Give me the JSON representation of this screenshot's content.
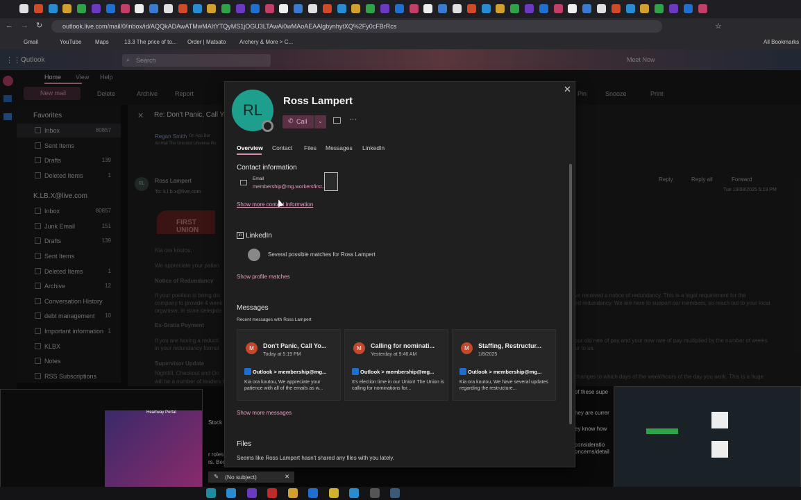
{
  "browser": {
    "url": "outlook.live.com/mail/0/inbox/id/AQQkADAwATMwMAItYTQyMS1jOGU3LTAwAi0wMAoAEAAlgbynhytXQ%2Fy0cFBrRcs",
    "bookmarks": [
      "Gmail",
      "YouTube",
      "Maps",
      "13.3 The price of to...",
      "Order | Matsato",
      "Archery & More > C..."
    ],
    "all_bookmarks": "All Bookmarks"
  },
  "outlook": {
    "app_name": "Outlook",
    "search_placeholder": "Search",
    "menu_tabs": [
      "Home",
      "View",
      "Help"
    ],
    "meet_now": "Meet Now",
    "ribbon": {
      "new_mail": "New mail",
      "delete": "Delete",
      "archive": "Archive",
      "report": "Report",
      "snooze": "Snooze",
      "print": "Print",
      "pin": "Pin"
    },
    "favorites_header": "Favorites",
    "favorites": [
      {
        "label": "Inbox",
        "count": "80857"
      },
      {
        "label": "Sent Items",
        "count": ""
      },
      {
        "label": "Drafts",
        "count": "139"
      },
      {
        "label": "Deleted Items",
        "count": "1"
      }
    ],
    "account": "K.LB.X@live.com",
    "folders": [
      {
        "label": "Inbox",
        "count": "80857"
      },
      {
        "label": "Junk Email",
        "count": "151"
      },
      {
        "label": "Drafts",
        "count": "139"
      },
      {
        "label": "Sent Items",
        "count": ""
      },
      {
        "label": "Deleted Items",
        "count": "1"
      },
      {
        "label": "Archive",
        "count": "12"
      },
      {
        "label": "Conversation History",
        "count": ""
      },
      {
        "label": "debt management",
        "count": "10"
      },
      {
        "label": "Important information",
        "count": "1"
      },
      {
        "label": "KLBX",
        "count": ""
      },
      {
        "label": "Notes",
        "count": ""
      },
      {
        "label": "RSS Subscriptions",
        "count": ""
      }
    ],
    "reading": {
      "subject": "Re: Don't Panic, Call Yo",
      "sender_initials": "RL",
      "sender": "Ross Lampert",
      "to": "To: k.l.b.x@live.com",
      "earlier_sender": "Regan Smith",
      "earlier_sender_app": "On App Bar",
      "earlier_preview": "All Hail The Unionist Universe Ro",
      "logo_text": "FIRST UNION",
      "date": "Tue 19/08/2025 5:19 PM",
      "actions": [
        "Reply",
        "Reply all",
        "Forward"
      ],
      "body_lines": [
        "Kia ora koutou,",
        "We appreciate your patien",
        "Notice of Redundancy",
        "If your position is being dis",
        "company to provide 4 week",
        "organiser, in store delegate",
        "Ex-Gratia Payment",
        "If you are having a reducti",
        "in your redundancy formul",
        "Supervisor Update",
        "Nightfill, Checkout and On",
        "will be a number of leaders th"
      ],
      "right_lines": [
        "ve received a notice of redundancy. This is a legal requirement for the",
        "ed redundancy. We are here to support our members, so reach out to your local",
        "our old rate of pay and your new rate of pay multiplied by the number of weeks",
        "ur to us.",
        "changes to which days of the week/hours of the day you work. This is a huge",
        "of these supe",
        "hey are currer",
        "ey know how",
        "consideratio",
        "oncerns/detail"
      ],
      "mid_fragments": [
        "Stock",
        "r roles",
        "rs. Becau"
      ]
    },
    "compose": "(No subject)"
  },
  "card": {
    "initials": "RL",
    "name": "Ross Lampert",
    "call_label": "Call",
    "tabs": [
      "Overview",
      "Contact",
      "Files",
      "Messages",
      "LinkedIn"
    ],
    "contact_header": "Contact information",
    "email_label": "Email",
    "email_value": "membership@mg.workersfirst...",
    "show_more_contact": "Show more contact information",
    "linkedin_header": "LinkedIn",
    "linkedin_matches": "Several possible matches for Ross Lampert",
    "show_profile_matches": "Show profile matches",
    "messages_header": "Messages",
    "recent_messages_label": "Recent messages with Ross Lampert",
    "messages": [
      {
        "initial": "M",
        "subject": "Don't Panic, Call Yo...",
        "time": "Today at 5:19 PM",
        "from": "Outlook > membership@mg...",
        "preview": "Kia ora koutou, We appreciate your patience with all of the emails as w..."
      },
      {
        "initial": "M",
        "subject": "Calling for nominati...",
        "time": "Yesterday at 9:46 AM",
        "from": "Outlook > membership@mg...",
        "preview": "It's election time in our Union! The Union is calling for nominations for..."
      },
      {
        "initial": "M",
        "subject": "Staffing, Restructur...",
        "time": "1/8/2025",
        "from": "Outlook > membership@mg...",
        "preview": "Kia ora koutou, We have several updates regarding the restructure..."
      }
    ],
    "show_more_messages": "Show more messages",
    "files_header": "Files",
    "files_empty": "Seems like Ross Lampert hasn't shared any files with you lately."
  },
  "pip_left": {
    "title": "Heartway Portal"
  },
  "colors": {
    "accent": "#e5a0c0",
    "avatar": "#1e9e8c",
    "msg_avatar": "#c2492a"
  }
}
